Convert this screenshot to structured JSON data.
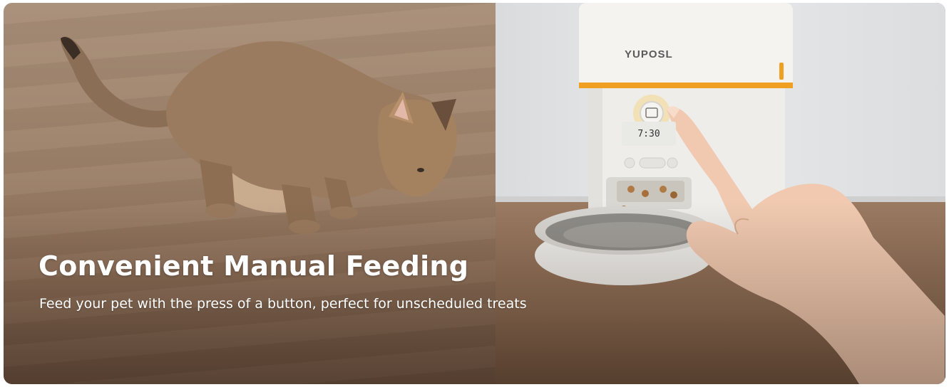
{
  "banner": {
    "headline": "Convenient Manual Feeding",
    "subheadline": "Feed your pet with the press of a button, perfect for unscheduled treats",
    "product_brand": "YUPOSL",
    "display_time": "7:30",
    "text_color": "#ffffff",
    "accent_color": "#f0a020"
  },
  "icons": [
    "cat-illustration",
    "pet-feeder-illustration",
    "hand-illustration",
    "manual-feed-button-icon"
  ]
}
